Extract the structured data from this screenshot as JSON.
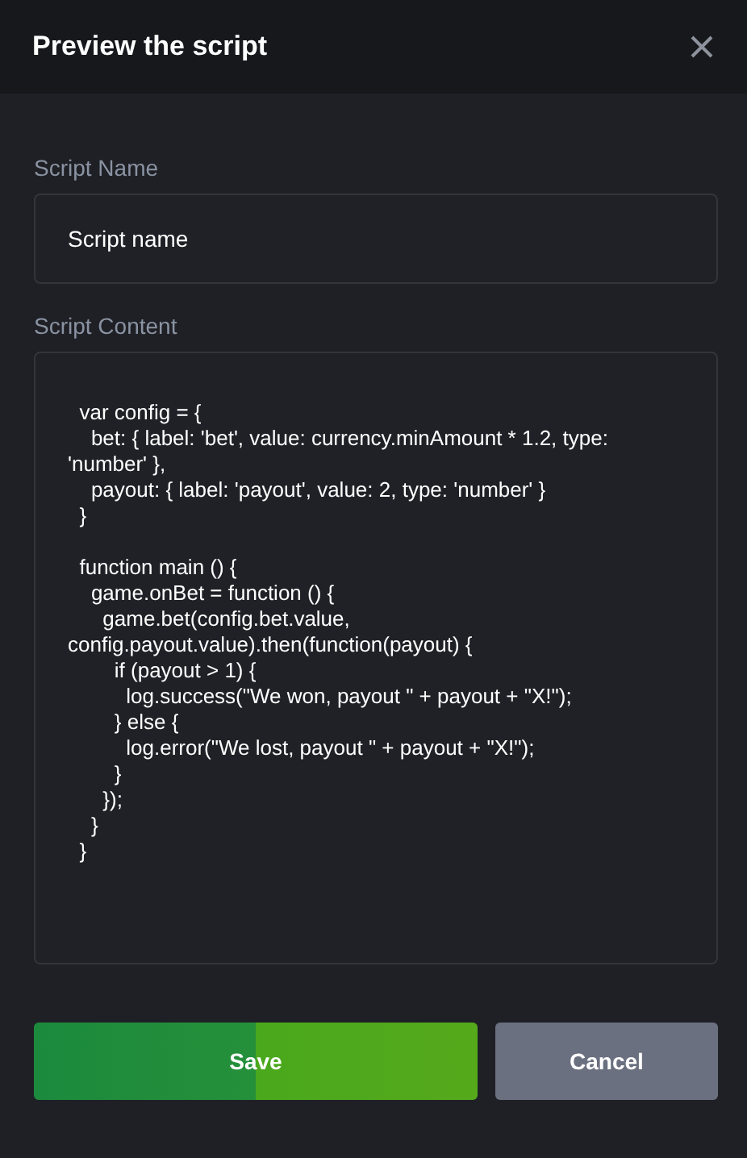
{
  "dialog": {
    "title": "Preview the script"
  },
  "fields": [
    {
      "kind": "line",
      "label": "Script Name",
      "value": "Script name"
    },
    {
      "kind": "code",
      "label": "Script Content",
      "value": "  var config = {\n    bet: { label: 'bet', value: currency.minAmount * 1.2, type: 'number' },\n    payout: { label: 'payout', value: 2, type: 'number' }\n  }\n\n  function main () {\n    game.onBet = function () {\n      game.bet(config.bet.value, config.payout.value).then(function(payout) {\n        if (payout > 1) {\n          log.success(\"We won, payout \" + payout + \"X!\");\n        } else {\n          log.error(\"We lost, payout \" + payout + \"X!\");\n        }\n      });\n    }\n  }"
    }
  ],
  "buttons": [
    {
      "kind": "primary",
      "label": "Save"
    },
    {
      "kind": "secondary",
      "label": "Cancel"
    }
  ]
}
